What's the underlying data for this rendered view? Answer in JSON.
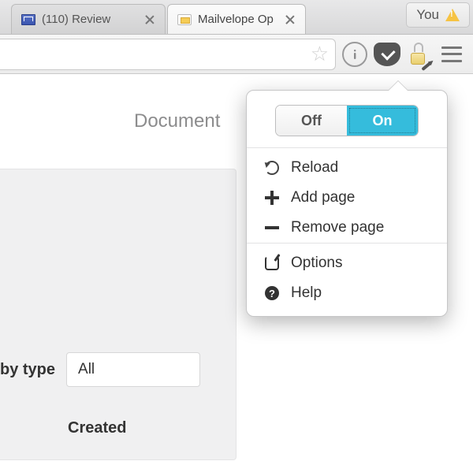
{
  "tabs": [
    {
      "title": "(110) Review"
    },
    {
      "title": "Mailvelope Op"
    }
  ],
  "you_label": "You",
  "page": {
    "heading_fragment": "Document",
    "filter_label_fragment": "by type",
    "filter_value": "All",
    "created_label": "Created"
  },
  "popup": {
    "off_label": "Off",
    "on_label": "On",
    "items": {
      "reload": "Reload",
      "add_page": "Add page",
      "remove_page": "Remove page",
      "options": "Options",
      "help": "Help"
    }
  }
}
